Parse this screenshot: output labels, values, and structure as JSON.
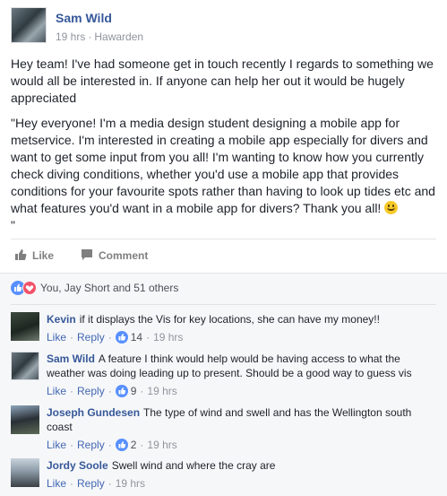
{
  "post": {
    "author": "Sam Wild",
    "time": "19 hrs",
    "separator": "·",
    "location": "Hawarden",
    "paragraph1": "Hey team! I've had someone get in touch recently I regards to something we would all be interested in. If anyone can help her out it would be hugely appreciated",
    "paragraph2": "\"Hey everyone! I'm a media design student designing a mobile app for metservice. I'm interested in creating a mobile app especially for divers and want to get some input from you all! I'm wanting to know how you currently check diving conditions, whether you'd use a mobile app that provides conditions for your favourite spots rather than having to look up tides etc and what features you'd want in a mobile app for divers? Thank you all!",
    "paragraph2_end": "\""
  },
  "actions": {
    "like": "Like",
    "comment": "Comment"
  },
  "reactions": {
    "summary": "You, Jay Short and 51 others"
  },
  "colors": {
    "link": "#365899",
    "like_blue": "#5890ff",
    "love_red": "#f25268",
    "background": "#f6f7f9"
  },
  "comments": [
    {
      "name": "Kevin",
      "text": "if it displays the Vis for key locations, she can have my money!!",
      "like": "Like",
      "reply": "Reply",
      "reactions": "14",
      "time": "19 hrs"
    },
    {
      "name": "Sam Wild",
      "text": "A feature I think would help would be having access to what the weather was doing leading up to present. Should be a good way to guess vis",
      "like": "Like",
      "reply": "Reply",
      "reactions": "9",
      "time": "19 hrs"
    },
    {
      "name": "Joseph Gundesen",
      "text": "The type of wind and swell and has the Wellington south coast",
      "like": "Like",
      "reply": "Reply",
      "reactions": "2",
      "time": "19 hrs"
    },
    {
      "name": "Jordy Soole",
      "text": "Swell wind and where the cray are",
      "like": "Like",
      "reply": "Reply",
      "time": "19 hrs"
    }
  ]
}
